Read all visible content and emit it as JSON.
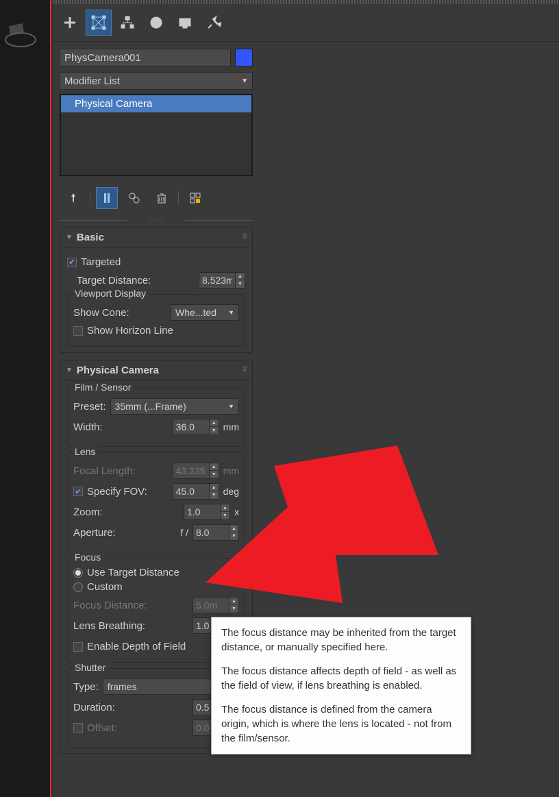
{
  "object_name": "PhysCamera001",
  "object_color": "#3355ff",
  "modifier_list_label": "Modifier List",
  "modifier_stack": {
    "item": "Physical Camera"
  },
  "rollouts": {
    "basic": {
      "title": "Basic",
      "targeted_label": "Targeted",
      "target_distance_label": "Target Distance:",
      "target_distance_value": "8.523m",
      "viewport_display_title": "Viewport Display",
      "show_cone_label": "Show Cone:",
      "show_cone_value": "Whe...ted",
      "show_horizon_label": "Show Horizon Line"
    },
    "physcam": {
      "title": "Physical Camera",
      "film_group": "Film / Sensor",
      "preset_label": "Preset:",
      "preset_value": "35mm (...Frame)",
      "width_label": "Width:",
      "width_value": "36.0",
      "width_unit": "mm",
      "lens_group": "Lens",
      "focal_length_label": "Focal Length:",
      "focal_length_value": "43.235",
      "focal_length_unit": "mm",
      "specify_fov_label": "Specify FOV:",
      "fov_value": "45.0",
      "fov_unit": "deg",
      "zoom_label": "Zoom:",
      "zoom_value": "1.0",
      "zoom_unit": "x",
      "aperture_label": "Aperture:",
      "aperture_prefix": "f /",
      "aperture_value": "8.0",
      "focus_group": "Focus",
      "use_target_label": "Use Target Distance",
      "custom_label": "Custom",
      "focus_distance_label": "Focus Distance:",
      "focus_distance_value": "5.0m",
      "lens_breathing_label": "Lens Breathing:",
      "lens_breathing_value": "1.0",
      "enable_dof_label": "Enable Depth of Field",
      "shutter_group": "Shutter",
      "type_label": "Type:",
      "type_value": "frames",
      "duration_label": "Duration:",
      "duration_value": "0.5",
      "offset_label": "Offset:",
      "offset_value": "0.0"
    }
  },
  "tooltip": {
    "p1": "The focus distance may be inherited from the target distance, or manually specified here.",
    "p2": "The focus distance affects depth of field - as well as the field of view, if lens breathing is enabled.",
    "p3": "The focus distance is defined from the camera origin, which is where the lens is located - not from the film/sensor."
  }
}
